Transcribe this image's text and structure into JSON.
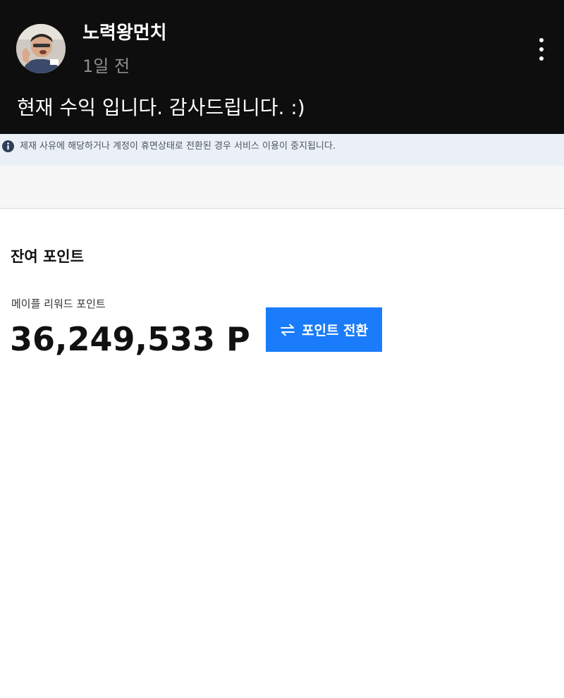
{
  "post": {
    "username": "노력왕먼치",
    "time": "1일 전",
    "text": "현재 수익 입니다. 감사드립니다. :)"
  },
  "notice": {
    "icon": "info-icon",
    "text": "제재 사유에 해당하거나 계정이 휴면상태로 전환된 경우 서비스 이용이 중지됩니다."
  },
  "points": {
    "section_title": "잔여 포인트",
    "label": "메이플 리워드 포인트",
    "value": "36,249,533 P",
    "convert_button_label": "포인트 전환",
    "convert_icon": "swap-arrows-icon"
  },
  "colors": {
    "header_bg": "#0e0e0e",
    "notice_bg": "#eaf0f6",
    "accent": "#1a7cfb"
  }
}
